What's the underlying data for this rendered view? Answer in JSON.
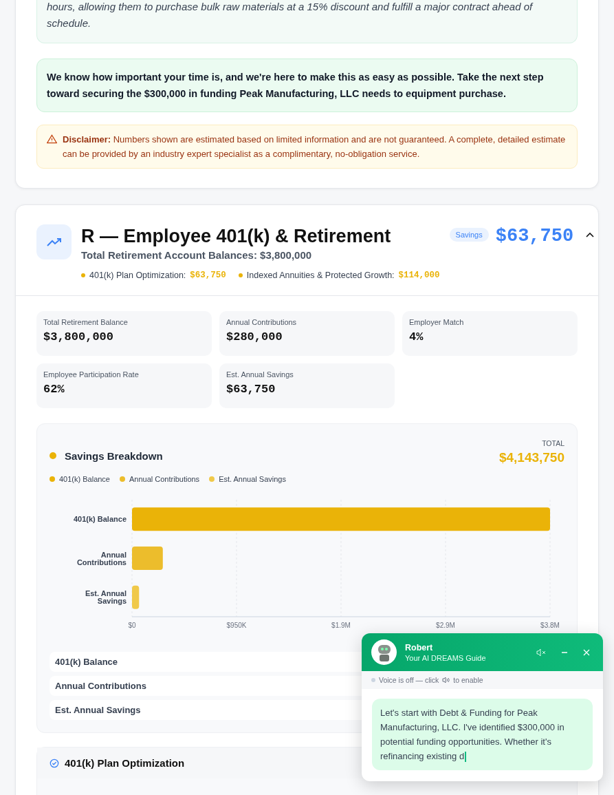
{
  "story": {
    "text": "hours, allowing them to purchase bulk raw materials at a 15% discount and fulfill a major contract ahead of schedule."
  },
  "callout": {
    "text": "We know how important your time is, and we're here to make this as easy as possible. Take the next step toward securing the $300,000 in funding Peak Manufacturing, LLC needs to equipment purchase."
  },
  "disclaimer": {
    "text": "**Disclaimer:** Numbers shown are estimated based on limited information and are not guaranteed. A complete, detailed estimate can be provided by an industry expert specialist as a complimentary, no-obligation service."
  },
  "section": {
    "title": "R — Employee 401(k) & Retirement",
    "subtitle": "Total Retirement Account Balances: $3,800,000",
    "badge": "Savings",
    "amount": "$63,750",
    "expanded": true,
    "highlights": [
      {
        "label": "401(k) Plan Optimization:",
        "value": "$63,750"
      },
      {
        "label": "Indexed Annuities & Protected Growth:",
        "value": "$114,000"
      }
    ]
  },
  "stats": [
    {
      "label": "Total Retirement Balance",
      "value": "$3,800,000"
    },
    {
      "label": "Annual Contributions",
      "value": "$280,000"
    },
    {
      "label": "Employer Match",
      "value": "4%"
    },
    {
      "label": "Employee Participation Rate",
      "value": "62%"
    },
    {
      "label": "Est. Annual Savings",
      "value": "$63,750"
    }
  ],
  "breakdown": {
    "title": "Savings Breakdown",
    "total_label": "TOTAL",
    "total": "$4,143,750",
    "legend": [
      {
        "label": "401(k) Balance",
        "color": "#eab308"
      },
      {
        "label": "Annual Contributions",
        "color": "#ecbd2c"
      },
      {
        "label": "Est. Annual Savings",
        "color": "#f0c94a"
      }
    ],
    "chart_data": {
      "type": "bar",
      "orientation": "horizontal",
      "grid": true,
      "categories": [
        "401(k) Balance",
        "Annual Contributions",
        "Est. Annual Savings"
      ],
      "values": [
        3800000,
        280000,
        64000
      ],
      "xlim": [
        0,
        3800000
      ],
      "xticks": [
        {
          "value": 0,
          "label": "$0"
        },
        {
          "value": 950000,
          "label": "$950K"
        },
        {
          "value": 1900000,
          "label": "$1.9M"
        },
        {
          "value": 2850000,
          "label": "$2.9M"
        },
        {
          "value": 3800000,
          "label": "$3.8M"
        }
      ]
    },
    "rows": [
      "401(k) Balance",
      "Annual Contributions",
      "Est. Annual Savings"
    ]
  },
  "subsection": {
    "title": "401(k) Plan Optimization"
  },
  "chat": {
    "name": "Robert",
    "role": "Your AI DREAMS Guide",
    "voice_on": false,
    "voice_before": "Voice is off — click",
    "voice_after": "to enable",
    "message": "Let's start with Debt & Funding for Peak Manufacturing, LLC. I've identified $300,000 in potential funding opportunities. Whether it's refinancing existing d"
  }
}
